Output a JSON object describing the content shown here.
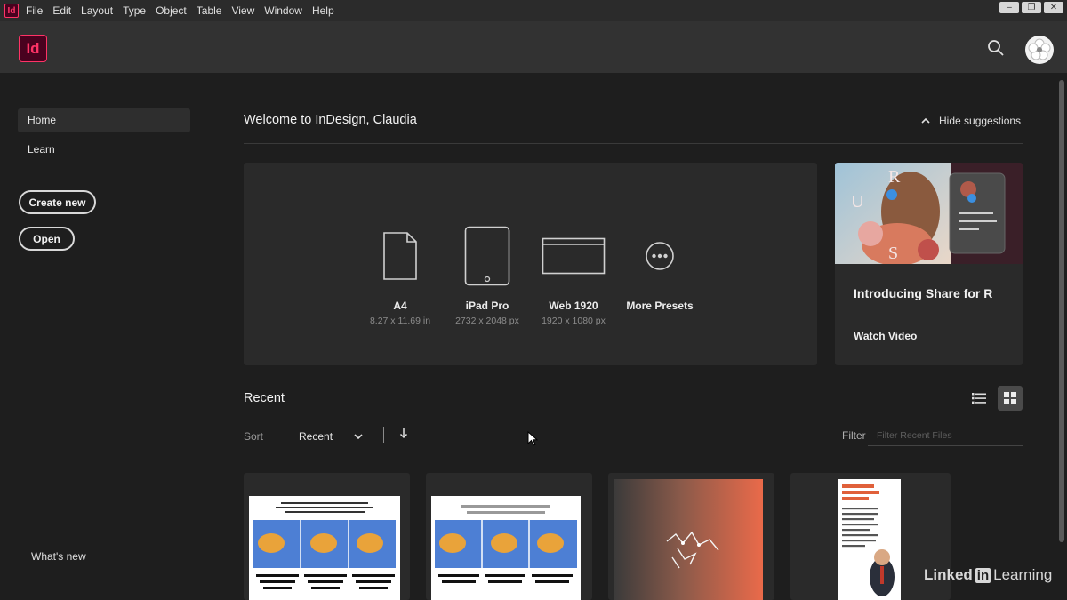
{
  "menubar": {
    "app_icon": "Id",
    "items": [
      "File",
      "Edit",
      "Layout",
      "Type",
      "Object",
      "Table",
      "View",
      "Window",
      "Help"
    ]
  },
  "header": {
    "app_logo": "Id",
    "search_icon": "search-icon",
    "avatar_icon": "flower-avatar"
  },
  "sidebar": {
    "items": [
      {
        "label": "Home",
        "active": true
      },
      {
        "label": "Learn",
        "active": false
      }
    ],
    "create_new": "Create new",
    "open": "Open",
    "whats_new": "What's new"
  },
  "main": {
    "welcome": "Welcome to InDesign, Claudia",
    "hide_suggestions": "Hide suggestions",
    "presets": [
      {
        "name": "A4",
        "size": "8.27 x 11.69 in",
        "icon": "document-icon"
      },
      {
        "name": "iPad Pro",
        "size": "2732 x 2048 px",
        "icon": "tablet-icon"
      },
      {
        "name": "Web 1920",
        "size": "1920 x 1080 px",
        "icon": "browser-window-icon"
      },
      {
        "name": "More Presets",
        "size": "",
        "icon": "more-icon"
      }
    ],
    "suggestion": {
      "title": "Introducing Share for R",
      "link": "Watch Video"
    },
    "recent": {
      "title": "Recent",
      "sort_label": "Sort",
      "sort_value": "Recent",
      "filter_label": "Filter",
      "filter_placeholder": "Filter Recent Files"
    }
  },
  "watermark": {
    "linkedin": "Linked",
    "in": "in",
    "learning": "Learning"
  },
  "colors": {
    "accent": "#ff3366",
    "background": "#1e1e1e",
    "panel": "#2a2a2a"
  }
}
